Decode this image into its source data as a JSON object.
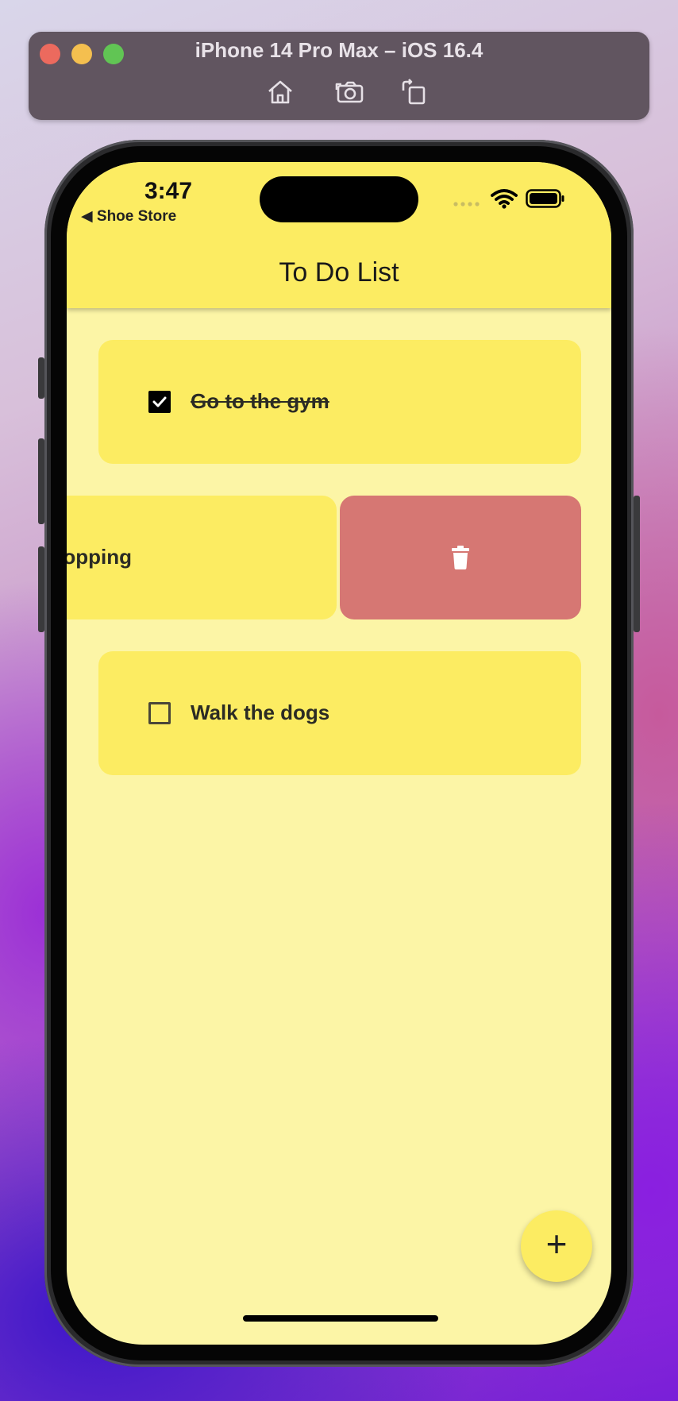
{
  "simulator": {
    "title": "iPhone 14 Pro Max – iOS 16.4",
    "buttons": [
      "home-icon",
      "screenshot-icon",
      "rotate-icon"
    ]
  },
  "status_bar": {
    "time": "3:47",
    "back_label": "◀ Shoe Store"
  },
  "app": {
    "title": "To Do List",
    "tasks": [
      {
        "label": "Go to the gym",
        "done": true
      },
      {
        "label": "opping",
        "done": false,
        "swiped": true
      },
      {
        "label": "Walk the dogs",
        "done": false
      }
    ],
    "fab_label": "+"
  },
  "colors": {
    "appbar": "#fcec62",
    "background": "#fcf5a6",
    "card": "#fcec62",
    "delete": "#d67773"
  }
}
